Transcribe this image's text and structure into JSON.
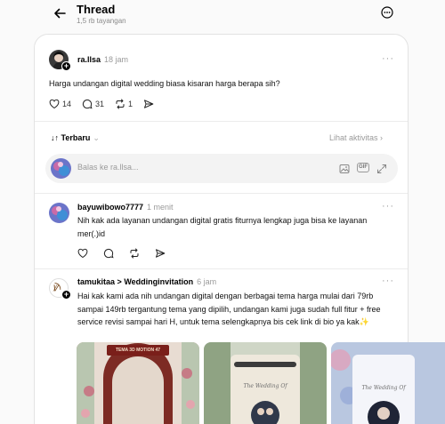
{
  "header": {
    "title": "Thread",
    "views": "1,5 rb tayangan"
  },
  "post": {
    "username": "ra.llsa",
    "time": "18 jam",
    "text": "Harga undangan digital wedding biasa kisaran harga berapa sih?",
    "likes": "14",
    "comments": "31",
    "reposts": "1"
  },
  "sort": {
    "label": "Terbaru",
    "activity": "Lihat aktivitas"
  },
  "reply_box": {
    "placeholder": "Balas ke ra.llsa...",
    "gif": "GIF"
  },
  "replies": [
    {
      "username": "bayuwibowo7777",
      "time": "1 menit",
      "text": "Nih kak ada layanan undangan digital gratis fiturnya lengkap juga bisa ke layanan mer(.)id"
    },
    {
      "username": "tamukitaa",
      "separator": ">",
      "target": "Weddinginvitation",
      "time": "6 jam",
      "text": "Hai kak kami ada nih undangan digital dengan berbagai tema harga mulai dari 79rb sampai 149rb tergantung tema yang dipilih, undangan kami juga sudah full fitur + free service revisi sampai hari H, untuk tema selengkapnya bis cek link di bio ya kak✨",
      "thumb_label": "TEMA 3D MOTION 47",
      "thumb_script_1": "The Wedding Of",
      "thumb_script_2": "The Wedding Of"
    }
  ],
  "colors": {
    "page_bg": "#fafafa",
    "card_bg": "#ffffff",
    "muted": "#9a9a9a"
  }
}
